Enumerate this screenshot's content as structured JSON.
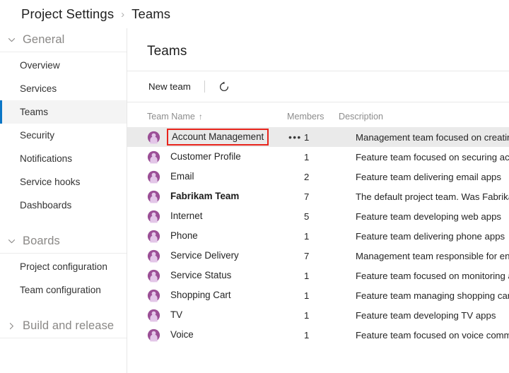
{
  "breadcrumb": {
    "parent": "Project Settings",
    "separator": "›",
    "current": "Teams"
  },
  "sidebar": {
    "groups": [
      {
        "title": "General",
        "expanded": true,
        "chevron": "chevron-down-icon",
        "items": [
          {
            "label": "Overview",
            "selected": false
          },
          {
            "label": "Services",
            "selected": false
          },
          {
            "label": "Teams",
            "selected": true
          },
          {
            "label": "Security",
            "selected": false
          },
          {
            "label": "Notifications",
            "selected": false
          },
          {
            "label": "Service hooks",
            "selected": false
          },
          {
            "label": "Dashboards",
            "selected": false
          }
        ]
      },
      {
        "title": "Boards",
        "expanded": true,
        "chevron": "chevron-down-icon",
        "items": [
          {
            "label": "Project configuration",
            "selected": false
          },
          {
            "label": "Team configuration",
            "selected": false
          }
        ]
      },
      {
        "title": "Build and release",
        "expanded": false,
        "chevron": "chevron-right-icon",
        "items": []
      }
    ]
  },
  "main": {
    "title": "Teams",
    "toolbar": {
      "new_team_label": "New team",
      "refresh_icon": "refresh-icon"
    },
    "grid": {
      "columns": {
        "name": "Team Name",
        "sort_indicator": "↑",
        "members": "Members",
        "description": "Description"
      },
      "rows": [
        {
          "avatar": "team-avatar-icon",
          "name": "Account Management",
          "members": "1",
          "description": "Management team focused on creating an",
          "selected": true,
          "highlighted": true,
          "bold": false,
          "show_ellipsis": true,
          "ellipsis_label": "•••"
        },
        {
          "avatar": "team-avatar-icon",
          "name": "Customer Profile",
          "members": "1",
          "description": "Feature team focused on securing account",
          "selected": false,
          "highlighted": false,
          "bold": false,
          "show_ellipsis": false,
          "ellipsis_label": ""
        },
        {
          "avatar": "team-avatar-icon",
          "name": "Email",
          "members": "2",
          "description": "Feature team delivering email apps",
          "selected": false,
          "highlighted": false,
          "bold": false,
          "show_ellipsis": false,
          "ellipsis_label": ""
        },
        {
          "avatar": "team-avatar-icon",
          "name": "Fabrikam Team",
          "members": "7",
          "description": "The default project team. Was Fabrikam Fi",
          "selected": false,
          "highlighted": false,
          "bold": true,
          "show_ellipsis": false,
          "ellipsis_label": ""
        },
        {
          "avatar": "team-avatar-icon",
          "name": "Internet",
          "members": "5",
          "description": "Feature team developing web apps",
          "selected": false,
          "highlighted": false,
          "bold": false,
          "show_ellipsis": false,
          "ellipsis_label": ""
        },
        {
          "avatar": "team-avatar-icon",
          "name": "Phone",
          "members": "1",
          "description": "Feature team delivering phone apps",
          "selected": false,
          "highlighted": false,
          "bold": false,
          "show_ellipsis": false,
          "ellipsis_label": ""
        },
        {
          "avatar": "team-avatar-icon",
          "name": "Service Delivery",
          "members": "7",
          "description": "Management team responsible for ensure",
          "selected": false,
          "highlighted": false,
          "bold": false,
          "show_ellipsis": false,
          "ellipsis_label": ""
        },
        {
          "avatar": "team-avatar-icon",
          "name": "Service Status",
          "members": "1",
          "description": "Feature team focused on monitoring and",
          "selected": false,
          "highlighted": false,
          "bold": false,
          "show_ellipsis": false,
          "ellipsis_label": ""
        },
        {
          "avatar": "team-avatar-icon",
          "name": "Shopping Cart",
          "members": "1",
          "description": "Feature team managing shopping cart app",
          "selected": false,
          "highlighted": false,
          "bold": false,
          "show_ellipsis": false,
          "ellipsis_label": ""
        },
        {
          "avatar": "team-avatar-icon",
          "name": "TV",
          "members": "1",
          "description": "Feature team developing TV apps",
          "selected": false,
          "highlighted": false,
          "bold": false,
          "show_ellipsis": false,
          "ellipsis_label": ""
        },
        {
          "avatar": "team-avatar-icon",
          "name": "Voice",
          "members": "1",
          "description": "Feature team focused on voice communic",
          "selected": false,
          "highlighted": false,
          "bold": false,
          "show_ellipsis": false,
          "ellipsis_label": ""
        }
      ]
    }
  },
  "colors": {
    "accent": "#0b76c6",
    "highlight_box": "#e8241c",
    "selected_row": "#eaeaea",
    "avatar_purple": "#9b4f96",
    "avatar_fill": "#e3c6e8",
    "muted_text": "#8d8d8d"
  }
}
